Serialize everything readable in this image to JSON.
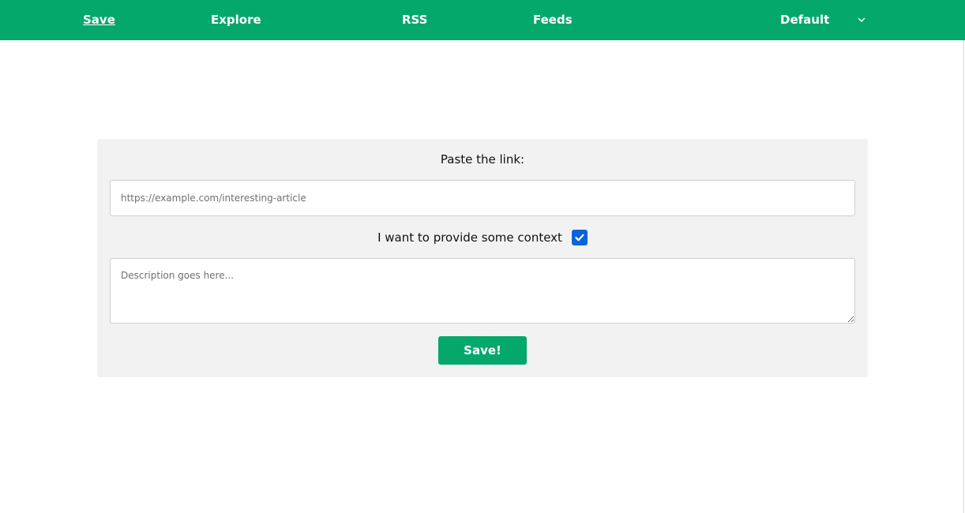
{
  "nav": {
    "items": [
      {
        "label": "Save",
        "active": true
      },
      {
        "label": "Explore"
      },
      {
        "label": "RSS"
      },
      {
        "label": "Feeds"
      }
    ],
    "theme_select": {
      "value": "Default",
      "icon": "chevron-down-icon"
    }
  },
  "form": {
    "link_label": "Paste the link:",
    "link_placeholder": "https://example.com/interesting-article",
    "context_label": "I want to provide some context",
    "context_checked": true,
    "description_placeholder": "Description goes here...",
    "submit_label": "Save!"
  },
  "colors": {
    "brand": "#04a86b",
    "checkbox": "#0b64d8",
    "card_bg": "#f2f2f2"
  }
}
